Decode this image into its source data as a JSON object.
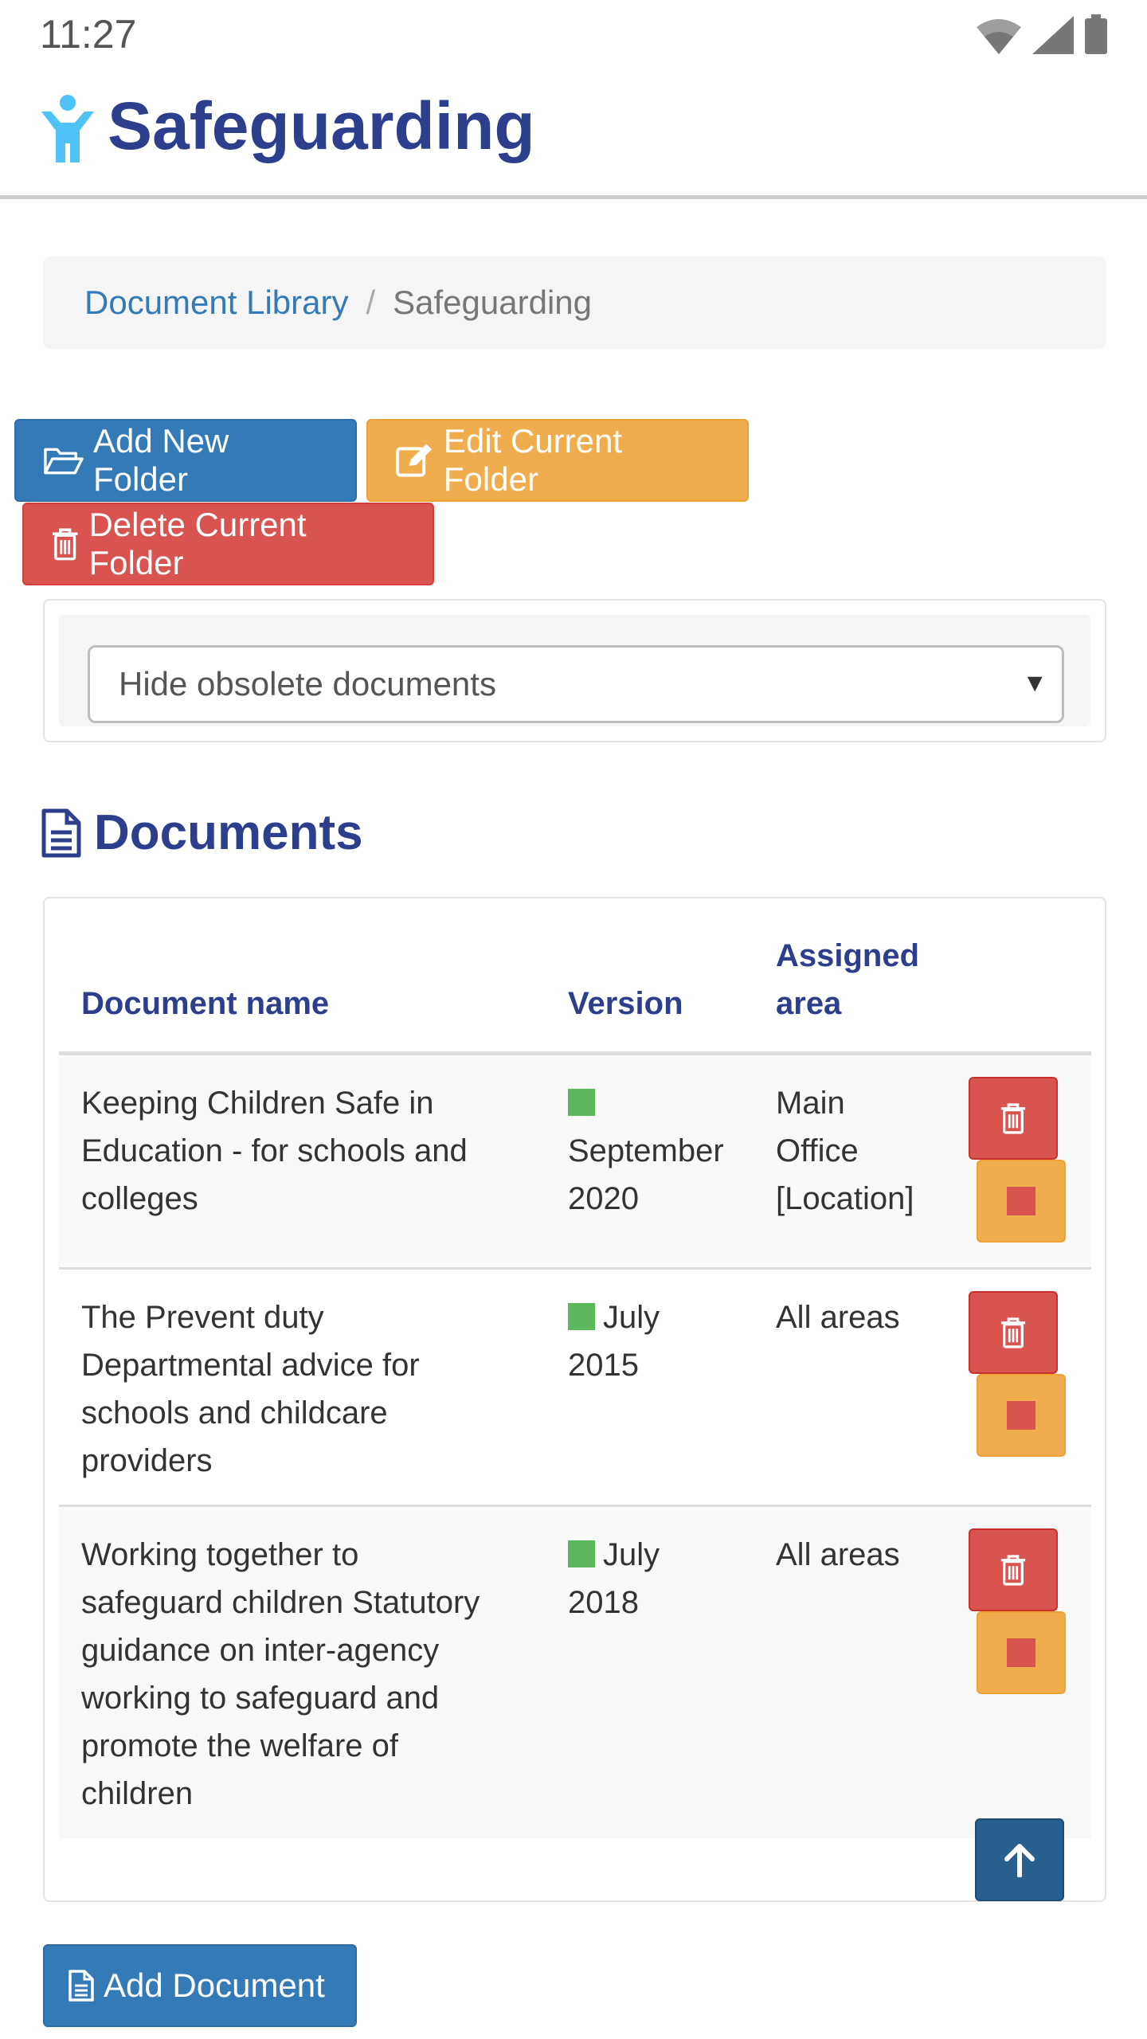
{
  "status_bar": {
    "time": "11:27"
  },
  "app": {
    "title": "Safeguarding"
  },
  "breadcrumb": {
    "items": [
      "Document Library",
      "Safeguarding"
    ],
    "separator": "/"
  },
  "folder_actions": {
    "add_label": "Add New Folder",
    "edit_label": "Edit Current Folder",
    "delete_label": "Delete Current Folder"
  },
  "filter": {
    "selected": "Hide obsolete documents"
  },
  "documents": {
    "heading": "Documents",
    "columns": {
      "name": "Document name",
      "version": "Version",
      "area_line1": "Assigned",
      "area_line2": "area"
    },
    "rows": [
      {
        "name": [
          "Keeping Children Safe in",
          "Education - for schools and",
          "colleges"
        ],
        "version": [
          "",
          "September",
          "2020"
        ],
        "area": [
          "Main",
          "Office",
          "[Location]"
        ],
        "status_color": "#5cb85c"
      },
      {
        "name": [
          "The Prevent duty",
          "Departmental advice for",
          "schools and childcare",
          "providers"
        ],
        "version": [
          "July",
          "2015"
        ],
        "area": [
          "All areas"
        ],
        "status_color": "#5cb85c"
      },
      {
        "name": [
          "Working together to",
          "safeguard children Statutory",
          "guidance on inter-agency",
          "working to safeguard and",
          "promote the welfare of",
          "children"
        ],
        "version": [
          "July",
          "2018"
        ],
        "area": [
          "All areas"
        ],
        "status_color": "#5cb85c"
      }
    ]
  },
  "add_document_label": "Add Document",
  "colors": {
    "primary": "#337ab7",
    "warning": "#f0ad4e",
    "danger": "#d9534f",
    "heading": "#2c3e8c",
    "success": "#5cb85c"
  }
}
